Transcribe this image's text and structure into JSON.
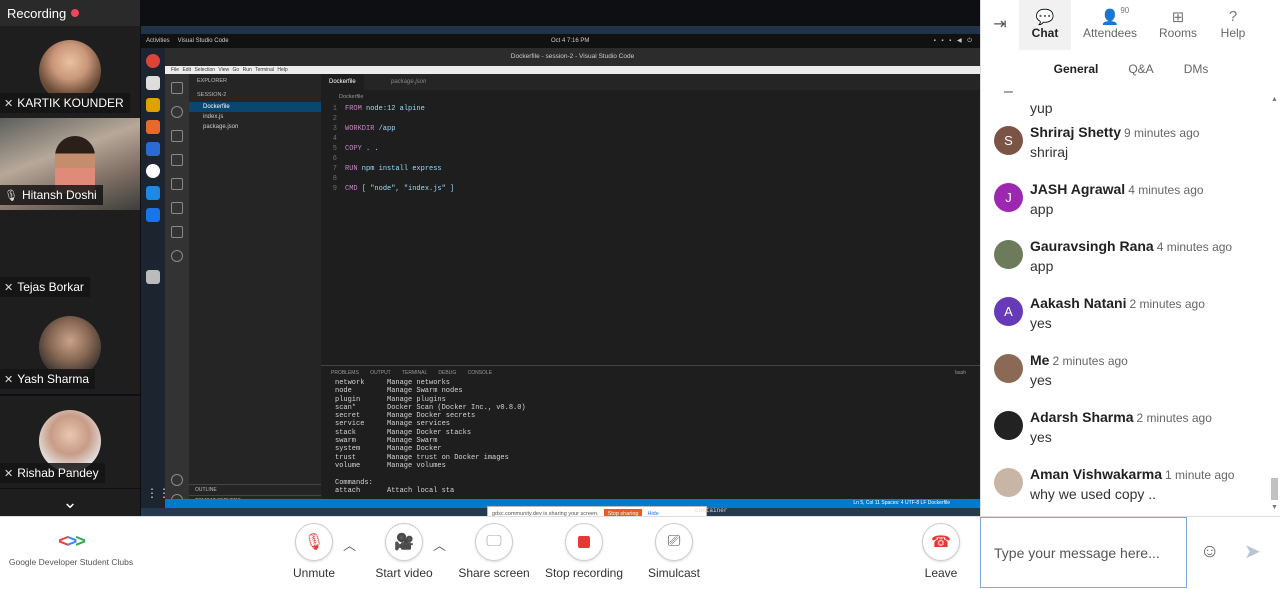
{
  "recording": {
    "label": "Recording"
  },
  "participants": [
    {
      "name": "KARTIK KOUNDER",
      "mic": "muted"
    },
    {
      "name": "Hitansh Doshi",
      "mic": "on"
    },
    {
      "name": "Tejas Borkar",
      "mic": "muted"
    },
    {
      "name": "Yash Sharma",
      "mic": "muted"
    },
    {
      "name": "Rishab Pandey",
      "mic": "muted"
    }
  ],
  "screen": {
    "gnome_activities": "Activities",
    "gnome_app": "Visual Studio Code",
    "clock": "Oct 4  7:16 PM",
    "window_title": "Dockerfile - session-2 - Visual Studio Code",
    "menu": "File  Edit  Selection  View  Go  Run  Terminal  Help",
    "explorer": {
      "header": "EXPLORER",
      "folder": "SESSION-2",
      "files": [
        "Dockerfile",
        "index.js",
        "package.json"
      ],
      "outline": "OUTLINE",
      "tomcat": "TOMCAT SERVERS"
    },
    "tabs": [
      "Dockerfile",
      "package.json"
    ],
    "breadcrumb": "Dockerfile",
    "code": [
      {
        "n": "1",
        "kw": "FROM",
        "rest": " node:12 alpine"
      },
      {
        "n": "2",
        "kw": "",
        "rest": ""
      },
      {
        "n": "3",
        "kw": "WORKDIR",
        "rest": " /app"
      },
      {
        "n": "4",
        "kw": "",
        "rest": ""
      },
      {
        "n": "5",
        "kw": "COPY",
        "rest": " . ."
      },
      {
        "n": "6",
        "kw": "",
        "rest": ""
      },
      {
        "n": "7",
        "kw": "RUN",
        "rest": " npm install express"
      },
      {
        "n": "8",
        "kw": "",
        "rest": ""
      },
      {
        "n": "9",
        "kw": "CMD",
        "rest": " [ \"node\", \"index.js\" ]"
      }
    ],
    "panel_tabs": "PROBLEMS  OUTPUT  TERMINAL  DEBUG CONSOLE",
    "terminal_shell": "bash",
    "terminal": [
      {
        "c": "network",
        "d": "Manage networks"
      },
      {
        "c": "node",
        "d": "Manage Swarm nodes"
      },
      {
        "c": "plugin",
        "d": "Manage plugins"
      },
      {
        "c": "scan*",
        "d": "Docker Scan (Docker Inc., v0.8.0)"
      },
      {
        "c": "secret",
        "d": "Manage Docker secrets"
      },
      {
        "c": "service",
        "d": "Manage services"
      },
      {
        "c": "stack",
        "d": "Manage Docker stacks"
      },
      {
        "c": "swarm",
        "d": "Manage Swarm"
      },
      {
        "c": "system",
        "d": "Manage Docker"
      },
      {
        "c": "trust",
        "d": "Manage trust on Docker images"
      },
      {
        "c": "volume",
        "d": "Manage volumes"
      },
      {
        "c": "",
        "d": ""
      },
      {
        "c": "Commands:",
        "d": ""
      },
      {
        "c": "attach",
        "d": "Attach local sta"
      }
    ],
    "terminal_tail": "container",
    "status": "Ln 5, Col 11   Spaces: 4   UTF-8   LF   Dockerfile",
    "share_bar": {
      "text": "gdsc.community.dev is sharing your screen.",
      "stop": "Stop sharing",
      "hide": "Hide"
    }
  },
  "panel": {
    "tabs": [
      {
        "label": "Chat",
        "icon": "chat-bubble-icon"
      },
      {
        "label": "Attendees",
        "icon": "people-icon",
        "badge": "90"
      },
      {
        "label": "Rooms",
        "icon": "grid-icon"
      },
      {
        "label": "Help",
        "icon": "question-icon"
      }
    ],
    "subtabs": [
      "General",
      "Q&A",
      "DMs"
    ],
    "messages": [
      {
        "name": "",
        "time": "",
        "text": "yup",
        "initial": "",
        "color": ""
      },
      {
        "name": "Shriraj Shetty",
        "time": "9 minutes ago",
        "text": "shriraj",
        "initial": "S",
        "color": "#7b5446"
      },
      {
        "name": "JASH Agrawal",
        "time": "4 minutes ago",
        "text": "app",
        "initial": "J",
        "color": "#9c27b0"
      },
      {
        "name": "Gauravsingh Rana",
        "time": "4 minutes ago",
        "text": "app",
        "initial": "",
        "color": "#6c7b5a"
      },
      {
        "name": "Aakash Natani",
        "time": "2 minutes ago",
        "text": "yes",
        "initial": "A",
        "color": "#673ab7"
      },
      {
        "name": "Me",
        "time": "2 minutes ago",
        "text": "yes",
        "initial": "",
        "color": "#8a6a55"
      },
      {
        "name": "Adarsh Sharma",
        "time": "2 minutes ago",
        "text": "yes",
        "initial": "",
        "color": "#222222"
      },
      {
        "name": "Aman Vishwakarma",
        "time": "1 minute ago",
        "text": "why we used copy ..",
        "initial": "",
        "color": "#c9b5a5"
      }
    ],
    "input_placeholder": "Type your message here..."
  },
  "controls": {
    "logo_text": "Google Developer Student Clubs",
    "unmute": "Unmute",
    "start_video": "Start video",
    "share_screen": "Share screen",
    "stop_recording": "Stop recording",
    "simulcast": "Simulcast",
    "leave": "Leave"
  },
  "colors": {
    "record_dot": "#f0455a",
    "stop_red": "#e53935",
    "accent_blue": "#1a73e8",
    "vscode_blue": "#007acc"
  }
}
